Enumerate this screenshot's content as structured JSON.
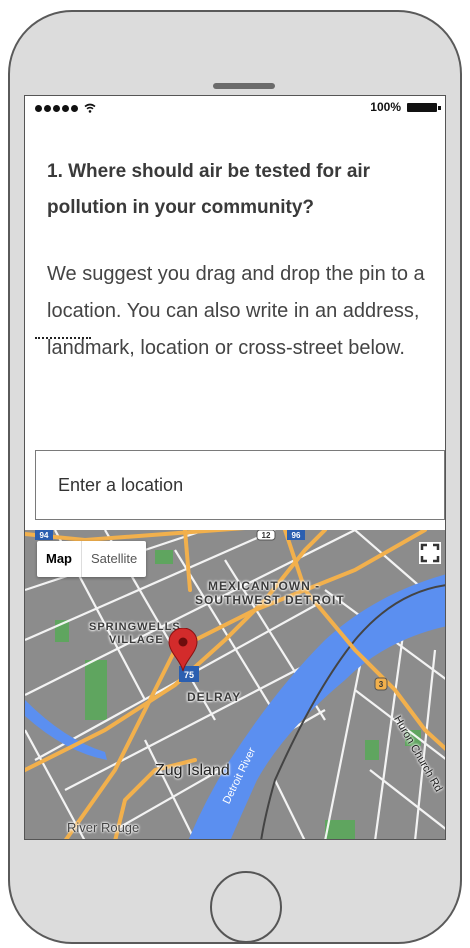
{
  "status_bar": {
    "signal_dots": 5,
    "battery_text": "100%"
  },
  "question": {
    "number_text": "1. Where should air be tested for air pollution in your community?"
  },
  "description": {
    "text": "We suggest you drag and drop the pin to a location. You can also write in an address, landmark, location or cross-street below."
  },
  "location_input": {
    "placeholder": "Enter a location"
  },
  "map": {
    "type_buttons": {
      "map_label": "Map",
      "satellite_label": "Satellite"
    },
    "labels": {
      "mexicantown": "MEXICANTOWN -",
      "southwest": "SOUTHWEST DETROIT",
      "springwells": "SPRINGWELLS",
      "village": "VILLAGE",
      "delray": "DELRAY",
      "zug_island": "Zug Island",
      "detroit_river": "Detroit River",
      "huron_church": "Huron Church Rd",
      "river_rouge": "River Rouge"
    },
    "shields": {
      "i94": "94",
      "r12": "12",
      "i96": "96",
      "i75": "75",
      "r3": "3"
    },
    "colors": {
      "land": "#8c8c8c",
      "water": "#5b8ff0",
      "highway": "#f2b04c",
      "park": "#5fa55f",
      "road": "#ffffff"
    }
  },
  "icons": [
    "signal-dots",
    "wifi-icon",
    "battery-icon",
    "map-pin-icon",
    "fullscreen-icon"
  ]
}
